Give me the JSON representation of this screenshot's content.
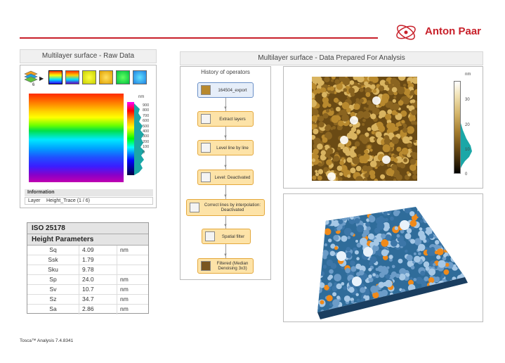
{
  "brand": {
    "name": "Anton Paar",
    "color": "#c8202a"
  },
  "raw_section": {
    "title": "Multilayer surface - Raw Data",
    "layers_count": "6",
    "colorbar_unit": "nm",
    "colorbar_ticks": [
      "900",
      "800",
      "700",
      "600",
      "500",
      "400",
      "300",
      "200",
      "100",
      "0"
    ],
    "info": {
      "heading": "Information",
      "key": "Layer",
      "value": "Height_Trace (1 / 6)"
    }
  },
  "iso": {
    "title": "ISO 25178",
    "subtitle": "Height Parameters",
    "rows": [
      {
        "param": "Sq",
        "value": "4.09",
        "unit": "nm"
      },
      {
        "param": "Ssk",
        "value": "1.79",
        "unit": ""
      },
      {
        "param": "Sku",
        "value": "9.78",
        "unit": ""
      },
      {
        "param": "Sp",
        "value": "24.0",
        "unit": "nm"
      },
      {
        "param": "Sv",
        "value": "10.7",
        "unit": "nm"
      },
      {
        "param": "Sz",
        "value": "34.7",
        "unit": "nm"
      },
      {
        "param": "Sa",
        "value": "2.86",
        "unit": "nm"
      }
    ]
  },
  "prepared_section": {
    "title": "Multilayer surface - Data Prepared For Analysis",
    "history_title": "History of operators",
    "operators": [
      "164504_export",
      "Extract layers",
      "Level line by line",
      "Level: Deactivated",
      "Correct lines by interpolation: Deactivated",
      "Spatial filter",
      "Filtered (Median Denoising 3x3)"
    ],
    "colorbar_unit": "nm",
    "colorbar_ticks": [
      "30",
      "20",
      "10",
      "0"
    ]
  },
  "footer": "Tosca™ Analysis 7.4.8341",
  "icons": [
    "anton-paar-logo",
    "layers-icon",
    "arrow-right-icon",
    "scan-thumbnail",
    "operator-icon",
    "down-arrow-icon"
  ]
}
